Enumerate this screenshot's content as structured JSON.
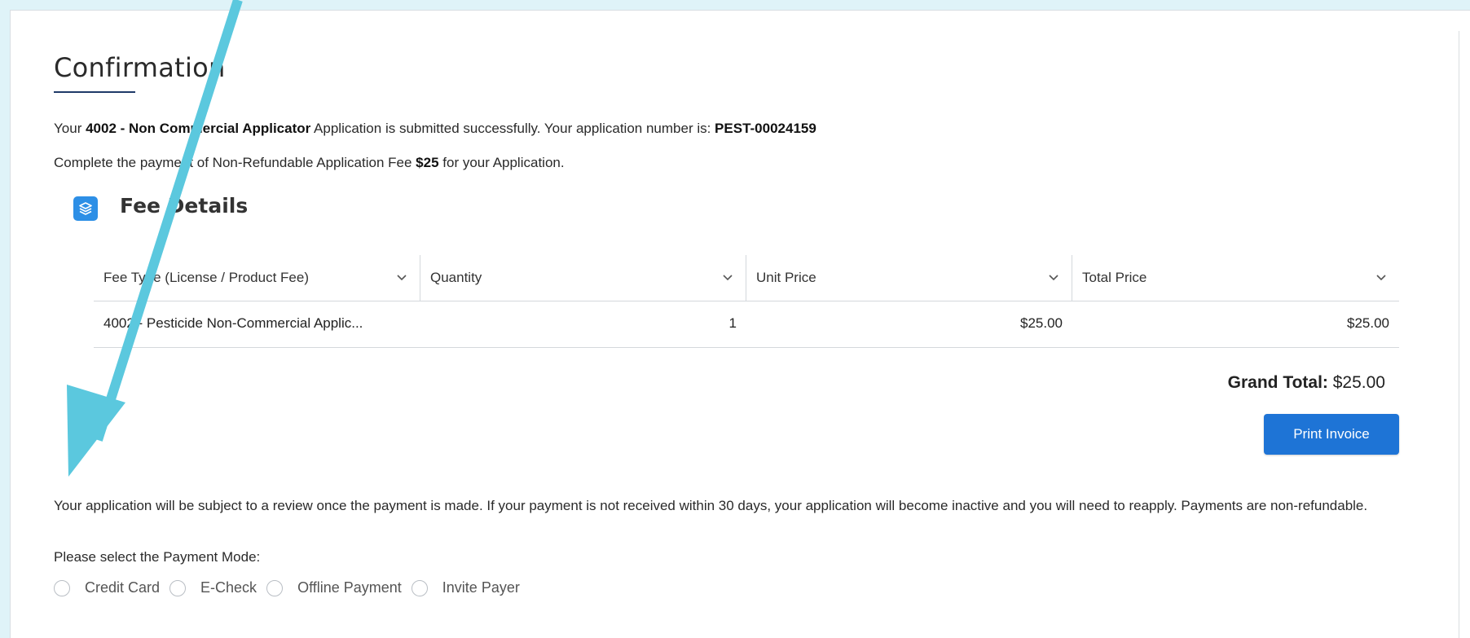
{
  "confirmation": {
    "title": "Confirmation",
    "line1": {
      "prefix": "Your ",
      "license_code": "4002",
      "dash": " - ",
      "license_name": "Non Commercial Applicator",
      "middle": " Application is submitted successfully. Your application number is: ",
      "application_number": "PEST-00024159"
    },
    "line2": {
      "prefix": "Complete the payment of Non-Refundable Application Fee ",
      "fee": "$25",
      "suffix": " for your Application."
    }
  },
  "fee_details": {
    "title": "Fee Details",
    "icon": "layers-icon",
    "columns": [
      "Fee Type (License / Product Fee)",
      "Quantity",
      "Unit Price",
      "Total Price"
    ],
    "rows": [
      {
        "fee_type": "4002 - Pesticide Non-Commercial Applic...",
        "quantity": "1",
        "unit_price": "$25.00",
        "total_price": "$25.00"
      }
    ],
    "grand_total_label": "Grand Total:",
    "grand_total_value": " $25.00",
    "print_button": "Print Invoice"
  },
  "notice": {
    "text": "Your application will be subject to a review once the payment is made. If your payment is not received within 30 days, your application will become inactive and you will need to reapply. Payments are non-refundable."
  },
  "payment_mode": {
    "label": "Please select the Payment Mode:",
    "options": [
      "Credit Card",
      "E-Check",
      "Offline Payment",
      "Invite Payer"
    ]
  },
  "colors": {
    "accent": "#1e74d6",
    "annotation_arrow": "#5bc8de",
    "title_underline": "#1f3a68",
    "background": "#dff3f8"
  }
}
